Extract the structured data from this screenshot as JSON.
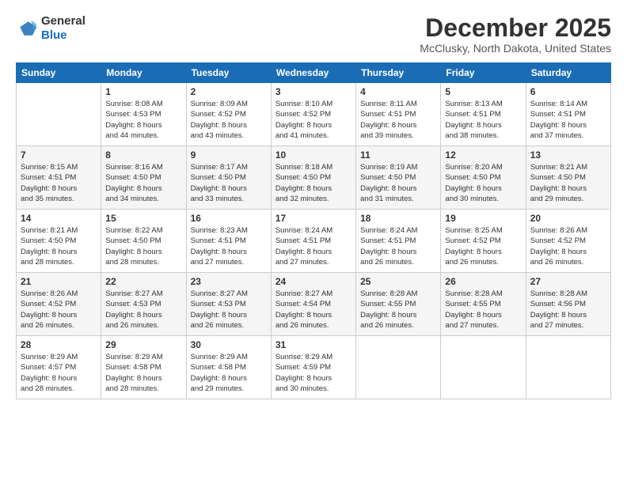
{
  "logo": {
    "line1": "General",
    "line2": "Blue"
  },
  "header": {
    "month": "December 2025",
    "location": "McClusky, North Dakota, United States"
  },
  "weekdays": [
    "Sunday",
    "Monday",
    "Tuesday",
    "Wednesday",
    "Thursday",
    "Friday",
    "Saturday"
  ],
  "weeks": [
    [
      {
        "day": "",
        "info": ""
      },
      {
        "day": "1",
        "info": "Sunrise: 8:08 AM\nSunset: 4:53 PM\nDaylight: 8 hours\nand 44 minutes."
      },
      {
        "day": "2",
        "info": "Sunrise: 8:09 AM\nSunset: 4:52 PM\nDaylight: 8 hours\nand 43 minutes."
      },
      {
        "day": "3",
        "info": "Sunrise: 8:10 AM\nSunset: 4:52 PM\nDaylight: 8 hours\nand 41 minutes."
      },
      {
        "day": "4",
        "info": "Sunrise: 8:11 AM\nSunset: 4:51 PM\nDaylight: 8 hours\nand 39 minutes."
      },
      {
        "day": "5",
        "info": "Sunrise: 8:13 AM\nSunset: 4:51 PM\nDaylight: 8 hours\nand 38 minutes."
      },
      {
        "day": "6",
        "info": "Sunrise: 8:14 AM\nSunset: 4:51 PM\nDaylight: 8 hours\nand 37 minutes."
      }
    ],
    [
      {
        "day": "7",
        "info": "Sunrise: 8:15 AM\nSunset: 4:51 PM\nDaylight: 8 hours\nand 35 minutes."
      },
      {
        "day": "8",
        "info": "Sunrise: 8:16 AM\nSunset: 4:50 PM\nDaylight: 8 hours\nand 34 minutes."
      },
      {
        "day": "9",
        "info": "Sunrise: 8:17 AM\nSunset: 4:50 PM\nDaylight: 8 hours\nand 33 minutes."
      },
      {
        "day": "10",
        "info": "Sunrise: 8:18 AM\nSunset: 4:50 PM\nDaylight: 8 hours\nand 32 minutes."
      },
      {
        "day": "11",
        "info": "Sunrise: 8:19 AM\nSunset: 4:50 PM\nDaylight: 8 hours\nand 31 minutes."
      },
      {
        "day": "12",
        "info": "Sunrise: 8:20 AM\nSunset: 4:50 PM\nDaylight: 8 hours\nand 30 minutes."
      },
      {
        "day": "13",
        "info": "Sunrise: 8:21 AM\nSunset: 4:50 PM\nDaylight: 8 hours\nand 29 minutes."
      }
    ],
    [
      {
        "day": "14",
        "info": "Sunrise: 8:21 AM\nSunset: 4:50 PM\nDaylight: 8 hours\nand 28 minutes."
      },
      {
        "day": "15",
        "info": "Sunrise: 8:22 AM\nSunset: 4:50 PM\nDaylight: 8 hours\nand 28 minutes."
      },
      {
        "day": "16",
        "info": "Sunrise: 8:23 AM\nSunset: 4:51 PM\nDaylight: 8 hours\nand 27 minutes."
      },
      {
        "day": "17",
        "info": "Sunrise: 8:24 AM\nSunset: 4:51 PM\nDaylight: 8 hours\nand 27 minutes."
      },
      {
        "day": "18",
        "info": "Sunrise: 8:24 AM\nSunset: 4:51 PM\nDaylight: 8 hours\nand 26 minutes."
      },
      {
        "day": "19",
        "info": "Sunrise: 8:25 AM\nSunset: 4:52 PM\nDaylight: 8 hours\nand 26 minutes."
      },
      {
        "day": "20",
        "info": "Sunrise: 8:26 AM\nSunset: 4:52 PM\nDaylight: 8 hours\nand 26 minutes."
      }
    ],
    [
      {
        "day": "21",
        "info": "Sunrise: 8:26 AM\nSunset: 4:52 PM\nDaylight: 8 hours\nand 26 minutes."
      },
      {
        "day": "22",
        "info": "Sunrise: 8:27 AM\nSunset: 4:53 PM\nDaylight: 8 hours\nand 26 minutes."
      },
      {
        "day": "23",
        "info": "Sunrise: 8:27 AM\nSunset: 4:53 PM\nDaylight: 8 hours\nand 26 minutes."
      },
      {
        "day": "24",
        "info": "Sunrise: 8:27 AM\nSunset: 4:54 PM\nDaylight: 8 hours\nand 26 minutes."
      },
      {
        "day": "25",
        "info": "Sunrise: 8:28 AM\nSunset: 4:55 PM\nDaylight: 8 hours\nand 26 minutes."
      },
      {
        "day": "26",
        "info": "Sunrise: 8:28 AM\nSunset: 4:55 PM\nDaylight: 8 hours\nand 27 minutes."
      },
      {
        "day": "27",
        "info": "Sunrise: 8:28 AM\nSunset: 4:56 PM\nDaylight: 8 hours\nand 27 minutes."
      }
    ],
    [
      {
        "day": "28",
        "info": "Sunrise: 8:29 AM\nSunset: 4:57 PM\nDaylight: 8 hours\nand 28 minutes."
      },
      {
        "day": "29",
        "info": "Sunrise: 8:29 AM\nSunset: 4:58 PM\nDaylight: 8 hours\nand 28 minutes."
      },
      {
        "day": "30",
        "info": "Sunrise: 8:29 AM\nSunset: 4:58 PM\nDaylight: 8 hours\nand 29 minutes."
      },
      {
        "day": "31",
        "info": "Sunrise: 8:29 AM\nSunset: 4:59 PM\nDaylight: 8 hours\nand 30 minutes."
      },
      {
        "day": "",
        "info": ""
      },
      {
        "day": "",
        "info": ""
      },
      {
        "day": "",
        "info": ""
      }
    ]
  ]
}
